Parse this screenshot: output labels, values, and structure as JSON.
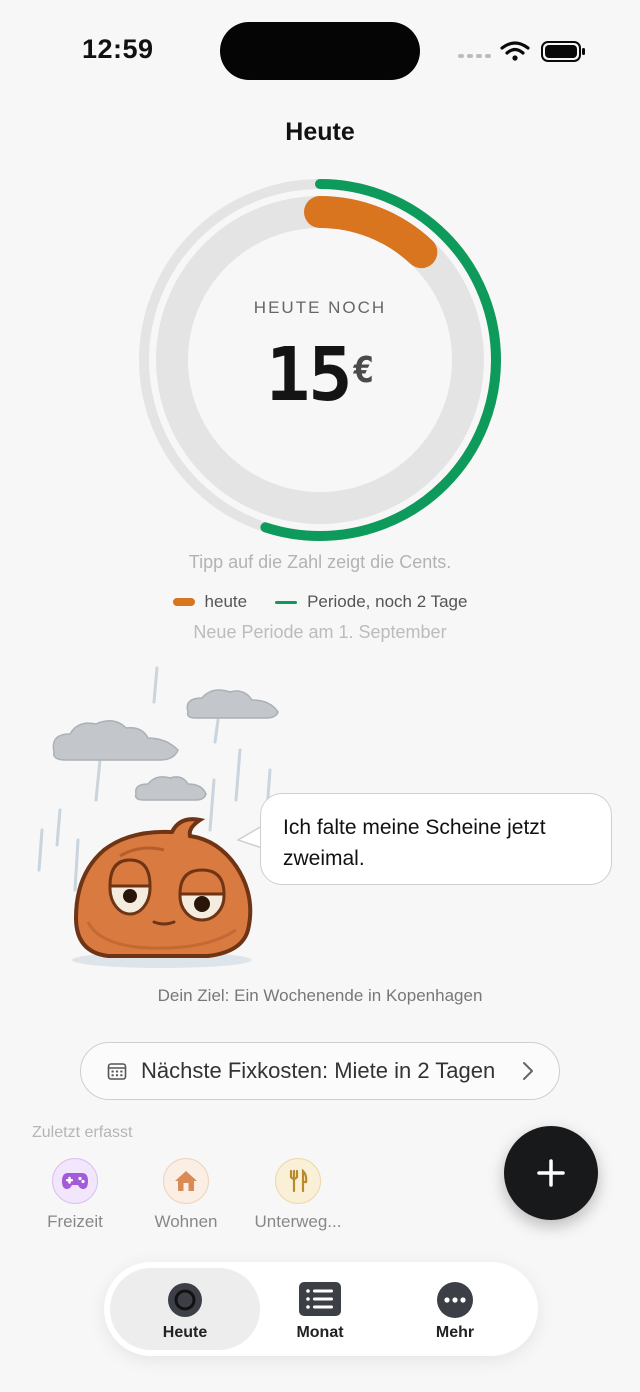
{
  "status": {
    "time": "12:59"
  },
  "title": "Heute",
  "ring": {
    "label": "HEUTE NOCH",
    "amount": "15",
    "currency": "€",
    "today_fraction": 0.12,
    "period_fraction": 0.55,
    "colors": {
      "today": "#d9741f",
      "period": "#0e9a5a",
      "track": "#e4e4e4"
    }
  },
  "hint": "Tipp auf die Zahl zeigt die Cents.",
  "legend": {
    "today": "heute",
    "period": "Periode, noch 2 Tage"
  },
  "period_note": "Neue Periode am 1. September",
  "mascot": {
    "speech": "Ich falte meine Scheine jetzt zweimal."
  },
  "goal": "Dein Ziel: Ein Wochenende in Kopenhagen",
  "fixcosts": {
    "label": "Nächste Fixkosten: Miete in 2 Tagen",
    "icon": "calendar-icon"
  },
  "recent": {
    "title": "Zuletzt erfasst",
    "items": [
      {
        "label": "Freizeit",
        "icon": "gamepad-icon",
        "color": "#a25bd9"
      },
      {
        "label": "Wohnen",
        "icon": "house-icon",
        "color": "#d98a57"
      },
      {
        "label": "Unterweg...",
        "icon": "fork-knife-icon",
        "color": "#b98a2a"
      }
    ]
  },
  "nav": {
    "tabs": [
      {
        "label": "Heute",
        "icon": "circle-icon",
        "selected": true
      },
      {
        "label": "Monat",
        "icon": "list-icon",
        "selected": false
      },
      {
        "label": "Mehr",
        "icon": "more-icon",
        "selected": false
      }
    ]
  }
}
